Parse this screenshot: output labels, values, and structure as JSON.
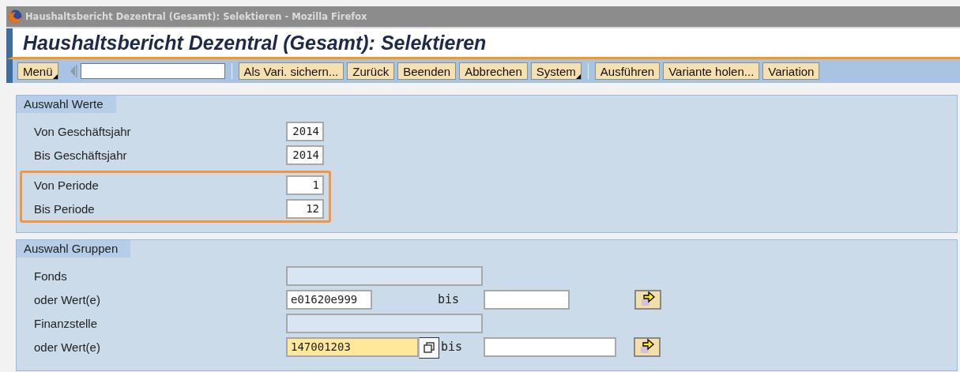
{
  "window": {
    "title": "Haushaltsbericht Dezentral (Gesamt): Selektieren - Mozilla Firefox"
  },
  "header": {
    "title": "Haushaltsbericht Dezentral (Gesamt): Selektieren"
  },
  "toolbar": {
    "items": [
      {
        "kind": "button",
        "label": "Menü",
        "menu": true
      },
      {
        "kind": "nav"
      },
      {
        "kind": "command-field"
      },
      {
        "kind": "separator"
      },
      {
        "kind": "button",
        "label": "Als Vari. sichern...",
        "menu": false
      },
      {
        "kind": "button",
        "label": "Zurück",
        "menu": false
      },
      {
        "kind": "button",
        "label": "Beenden",
        "menu": false
      },
      {
        "kind": "button",
        "label": "Abbrechen",
        "menu": false
      },
      {
        "kind": "button",
        "label": "System",
        "menu": true
      },
      {
        "kind": "separator"
      },
      {
        "kind": "button",
        "label": "Ausführen",
        "menu": false
      },
      {
        "kind": "button",
        "label": "Variante holen...",
        "menu": false
      },
      {
        "kind": "button",
        "label": "Variation",
        "menu": false
      }
    ]
  },
  "panels": [
    {
      "title": "Auswahl Werte",
      "groups": [
        {
          "highlighted": false,
          "rows": [
            {
              "kind": "single",
              "label": "Von Geschäftsjahr",
              "value": "2014"
            },
            {
              "kind": "single",
              "label": "Bis Geschäftsjahr",
              "value": "2014"
            }
          ]
        },
        {
          "highlighted": true,
          "rows": [
            {
              "kind": "single",
              "label": "Von Periode",
              "value": "1"
            },
            {
              "kind": "single",
              "label": "Bis Periode",
              "value": "12"
            }
          ]
        }
      ]
    },
    {
      "title": "Auswahl Gruppen",
      "groups": [
        {
          "highlighted": false,
          "rows": [
            {
              "kind": "disabled",
              "label": "Fonds"
            },
            {
              "kind": "range",
              "label": "oder Wert(e)",
              "value": "e01620e999",
              "to_label": "bis",
              "wide": false,
              "focused": false
            },
            {
              "kind": "disabled",
              "label": "Finanzstelle"
            },
            {
              "kind": "range",
              "label": "oder Wert(e)",
              "value": "147001203",
              "to_label": "bis",
              "wide": true,
              "focused": true
            }
          ]
        }
      ]
    }
  ]
}
